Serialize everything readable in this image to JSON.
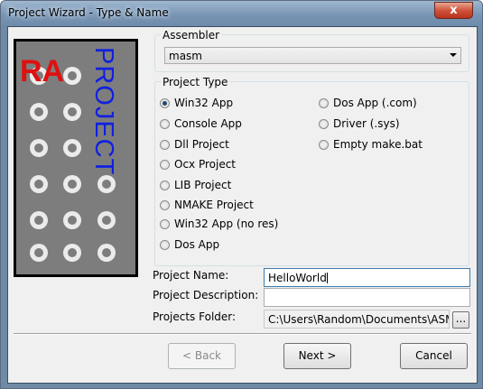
{
  "window": {
    "title": "Project Wizard - Type & Name",
    "close_label": "x"
  },
  "banner": {
    "logo_text": "RA",
    "text": "PROJECT"
  },
  "assembler": {
    "group_label": "Assembler",
    "selected": "masm"
  },
  "project_type": {
    "group_label": "Project Type",
    "options": [
      {
        "label": "Win32 App",
        "checked": true
      },
      {
        "label": "Console App",
        "checked": false
      },
      {
        "label": "Dll Project",
        "checked": false
      },
      {
        "label": "Ocx Project",
        "checked": false
      },
      {
        "label": "LIB Project",
        "checked": false
      },
      {
        "label": "NMAKE Project",
        "checked": false
      },
      {
        "label": "Win32 App (no res)",
        "checked": false
      },
      {
        "label": "Dos App",
        "checked": false
      },
      {
        "label": "Dos App (.com)",
        "checked": false
      },
      {
        "label": "Driver (.sys)",
        "checked": false
      },
      {
        "label": "Empty make.bat",
        "checked": false
      }
    ]
  },
  "project_name": {
    "label": "Project Name:",
    "value": "HelloWorld"
  },
  "project_description": {
    "label": "Project Description:",
    "value": ""
  },
  "projects_folder": {
    "label": "Projects Folder:",
    "value": "C:\\Users\\Random\\Documents\\ASM P",
    "browse_label": "..."
  },
  "buttons": {
    "back": "< Back",
    "next": "Next >",
    "cancel": "Cancel"
  }
}
